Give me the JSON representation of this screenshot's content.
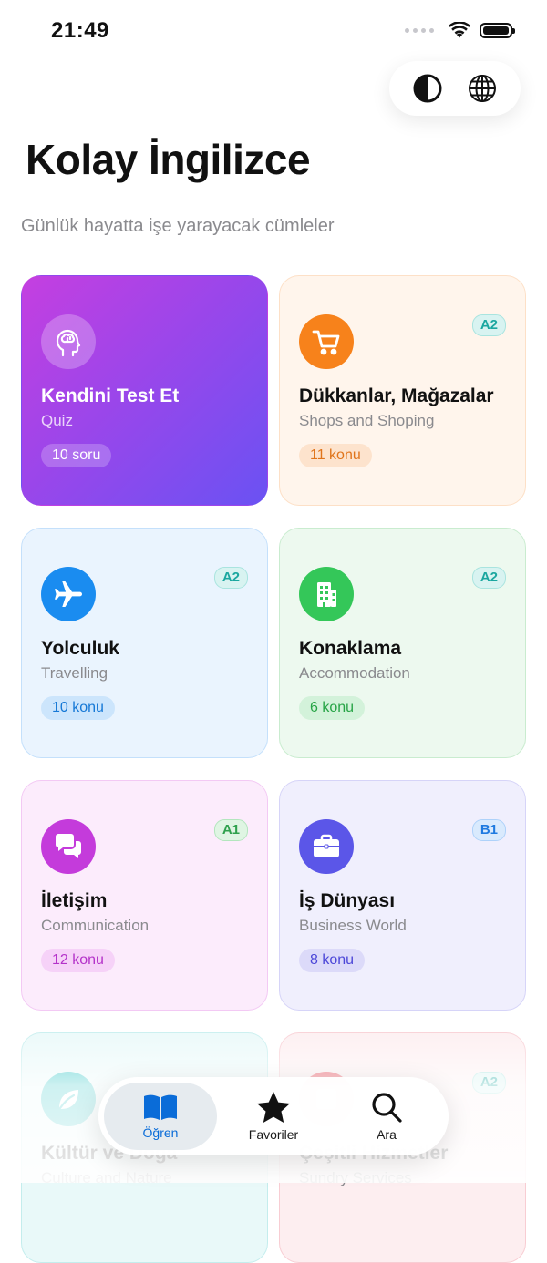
{
  "status": {
    "time": "21:49"
  },
  "header": {
    "title": "Kolay İngilizce",
    "subtitle": "Günlük hayatta işe yarayacak cümleler"
  },
  "cards": [
    {
      "title": "Kendini Test Et",
      "subtitle": "Quiz",
      "count": "10 soru",
      "level": "",
      "icon": "brain-head-icon",
      "color": "#b845e6"
    },
    {
      "title": "Dükkanlar, Mağazalar",
      "subtitle": "Shops and Shoping",
      "count": "11 konu",
      "level": "A2",
      "icon": "shopping-cart-icon",
      "color": "#f7821b"
    },
    {
      "title": "Yolculuk",
      "subtitle": "Travelling",
      "count": "10 konu",
      "level": "A2",
      "icon": "airplane-icon",
      "color": "#1a8cf0"
    },
    {
      "title": "Konaklama",
      "subtitle": "Accommodation",
      "count": "6 konu",
      "level": "A2",
      "icon": "building-icon",
      "color": "#34c759"
    },
    {
      "title": "İletişim",
      "subtitle": "Communication",
      "count": "12 konu",
      "level": "A1",
      "icon": "chat-bubbles-icon",
      "color": "#c43bdb"
    },
    {
      "title": "İş Dünyası",
      "subtitle": "Business World",
      "count": "8 konu",
      "level": "B1",
      "icon": "briefcase-icon",
      "color": "#5b56e8"
    },
    {
      "title": "Kültür ve Doğa",
      "subtitle": "Culture and Nature",
      "count": "",
      "level": "",
      "icon": "leaf-icon",
      "color": "#3cc8c8"
    },
    {
      "title": "Çeşitli Hizmetler",
      "subtitle": "Sundry Services",
      "count": "",
      "level": "A2",
      "icon": "services-icon",
      "color": "#ef4b5a"
    }
  ],
  "tabbar": {
    "tabs": [
      {
        "label": "Öğren",
        "icon": "book-icon",
        "active": true
      },
      {
        "label": "Favoriler",
        "icon": "star-icon",
        "active": false
      },
      {
        "label": "Ara",
        "icon": "search-icon",
        "active": false
      }
    ]
  },
  "colors": {
    "accent": "#0a6cd8"
  }
}
